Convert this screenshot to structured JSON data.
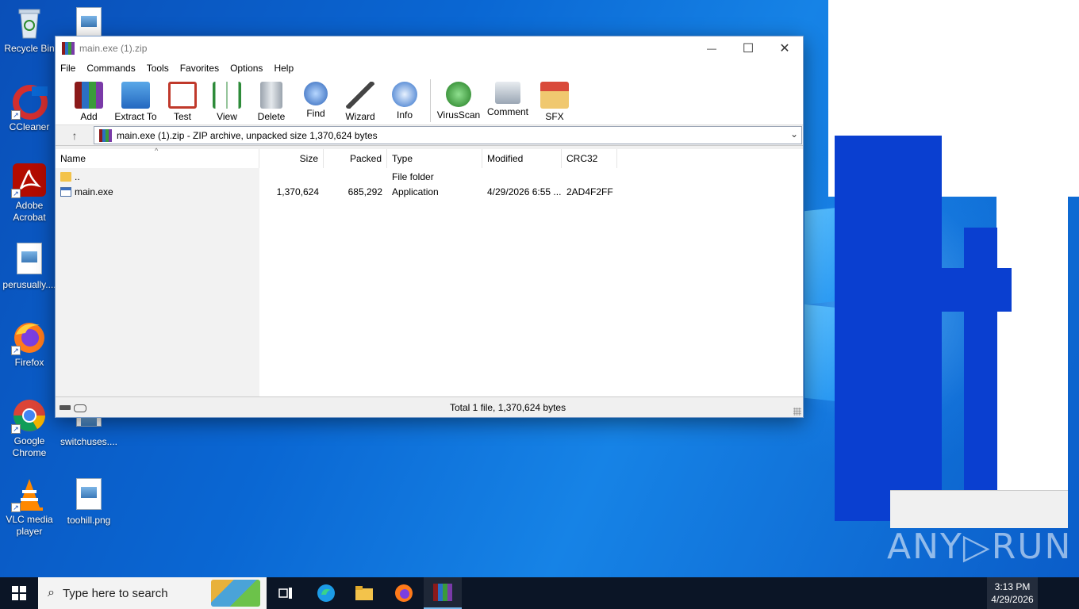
{
  "desktop": {
    "icons": [
      {
        "label": "Recycle Bin"
      },
      {
        "label": "CCleaner"
      },
      {
        "label": "Adobe Acrobat"
      },
      {
        "label": "perusually...."
      },
      {
        "label": "Firefox"
      },
      {
        "label": "Google Chrome"
      },
      {
        "label": "switchuses...."
      },
      {
        "label": "VLC media player"
      },
      {
        "label": "toohill.png"
      }
    ]
  },
  "window": {
    "title": "main.exe (1).zip",
    "minimize_glyph": "—",
    "maximize_glyph": "☐",
    "close_glyph": "✕",
    "menu": [
      "File",
      "Commands",
      "Tools",
      "Favorites",
      "Options",
      "Help"
    ],
    "toolbar": [
      {
        "label": "Add",
        "icon": "add-archive-icon"
      },
      {
        "label": "Extract To",
        "icon": "extract-folder-icon"
      },
      {
        "label": "Test",
        "icon": "test-clipboard-icon"
      },
      {
        "label": "View",
        "icon": "book-view-icon"
      },
      {
        "label": "Delete",
        "icon": "trash-can-icon"
      },
      {
        "label": "Find",
        "icon": "magnifier-icon"
      },
      {
        "label": "Wizard",
        "icon": "magic-wand-icon"
      },
      {
        "label": "Info",
        "icon": "info-icon"
      },
      {
        "label": "VirusScan",
        "icon": "virus-scan-icon"
      },
      {
        "label": "Comment",
        "icon": "comment-icon"
      },
      {
        "label": "SFX",
        "icon": "sfx-box-icon"
      }
    ],
    "address": "main.exe (1).zip - ZIP archive, unpacked size 1,370,624 bytes",
    "columns": {
      "name": "Name",
      "size": "Size",
      "packed": "Packed",
      "type": "Type",
      "modified": "Modified",
      "crc": "CRC32"
    },
    "rows": [
      {
        "name": "..",
        "size": "",
        "packed": "",
        "type": "File folder",
        "modified": "",
        "crc": ""
      },
      {
        "name": "main.exe",
        "size": "1,370,624",
        "packed": "685,292",
        "type": "Application",
        "modified": "4/29/2026 6:55 ...",
        "crc": "2AD4F2FF"
      }
    ],
    "status": "Total 1 file, 1,370,624 bytes"
  },
  "taskbar": {
    "search_placeholder": "Type here to search",
    "time": "3:13 PM",
    "date": "4/29/2026"
  },
  "watermark": "ANY▷RUN",
  "colors": {
    "desktop_blue": "#0a67d3",
    "taskbar": "#0b1526",
    "accent": "#76b9ed"
  }
}
